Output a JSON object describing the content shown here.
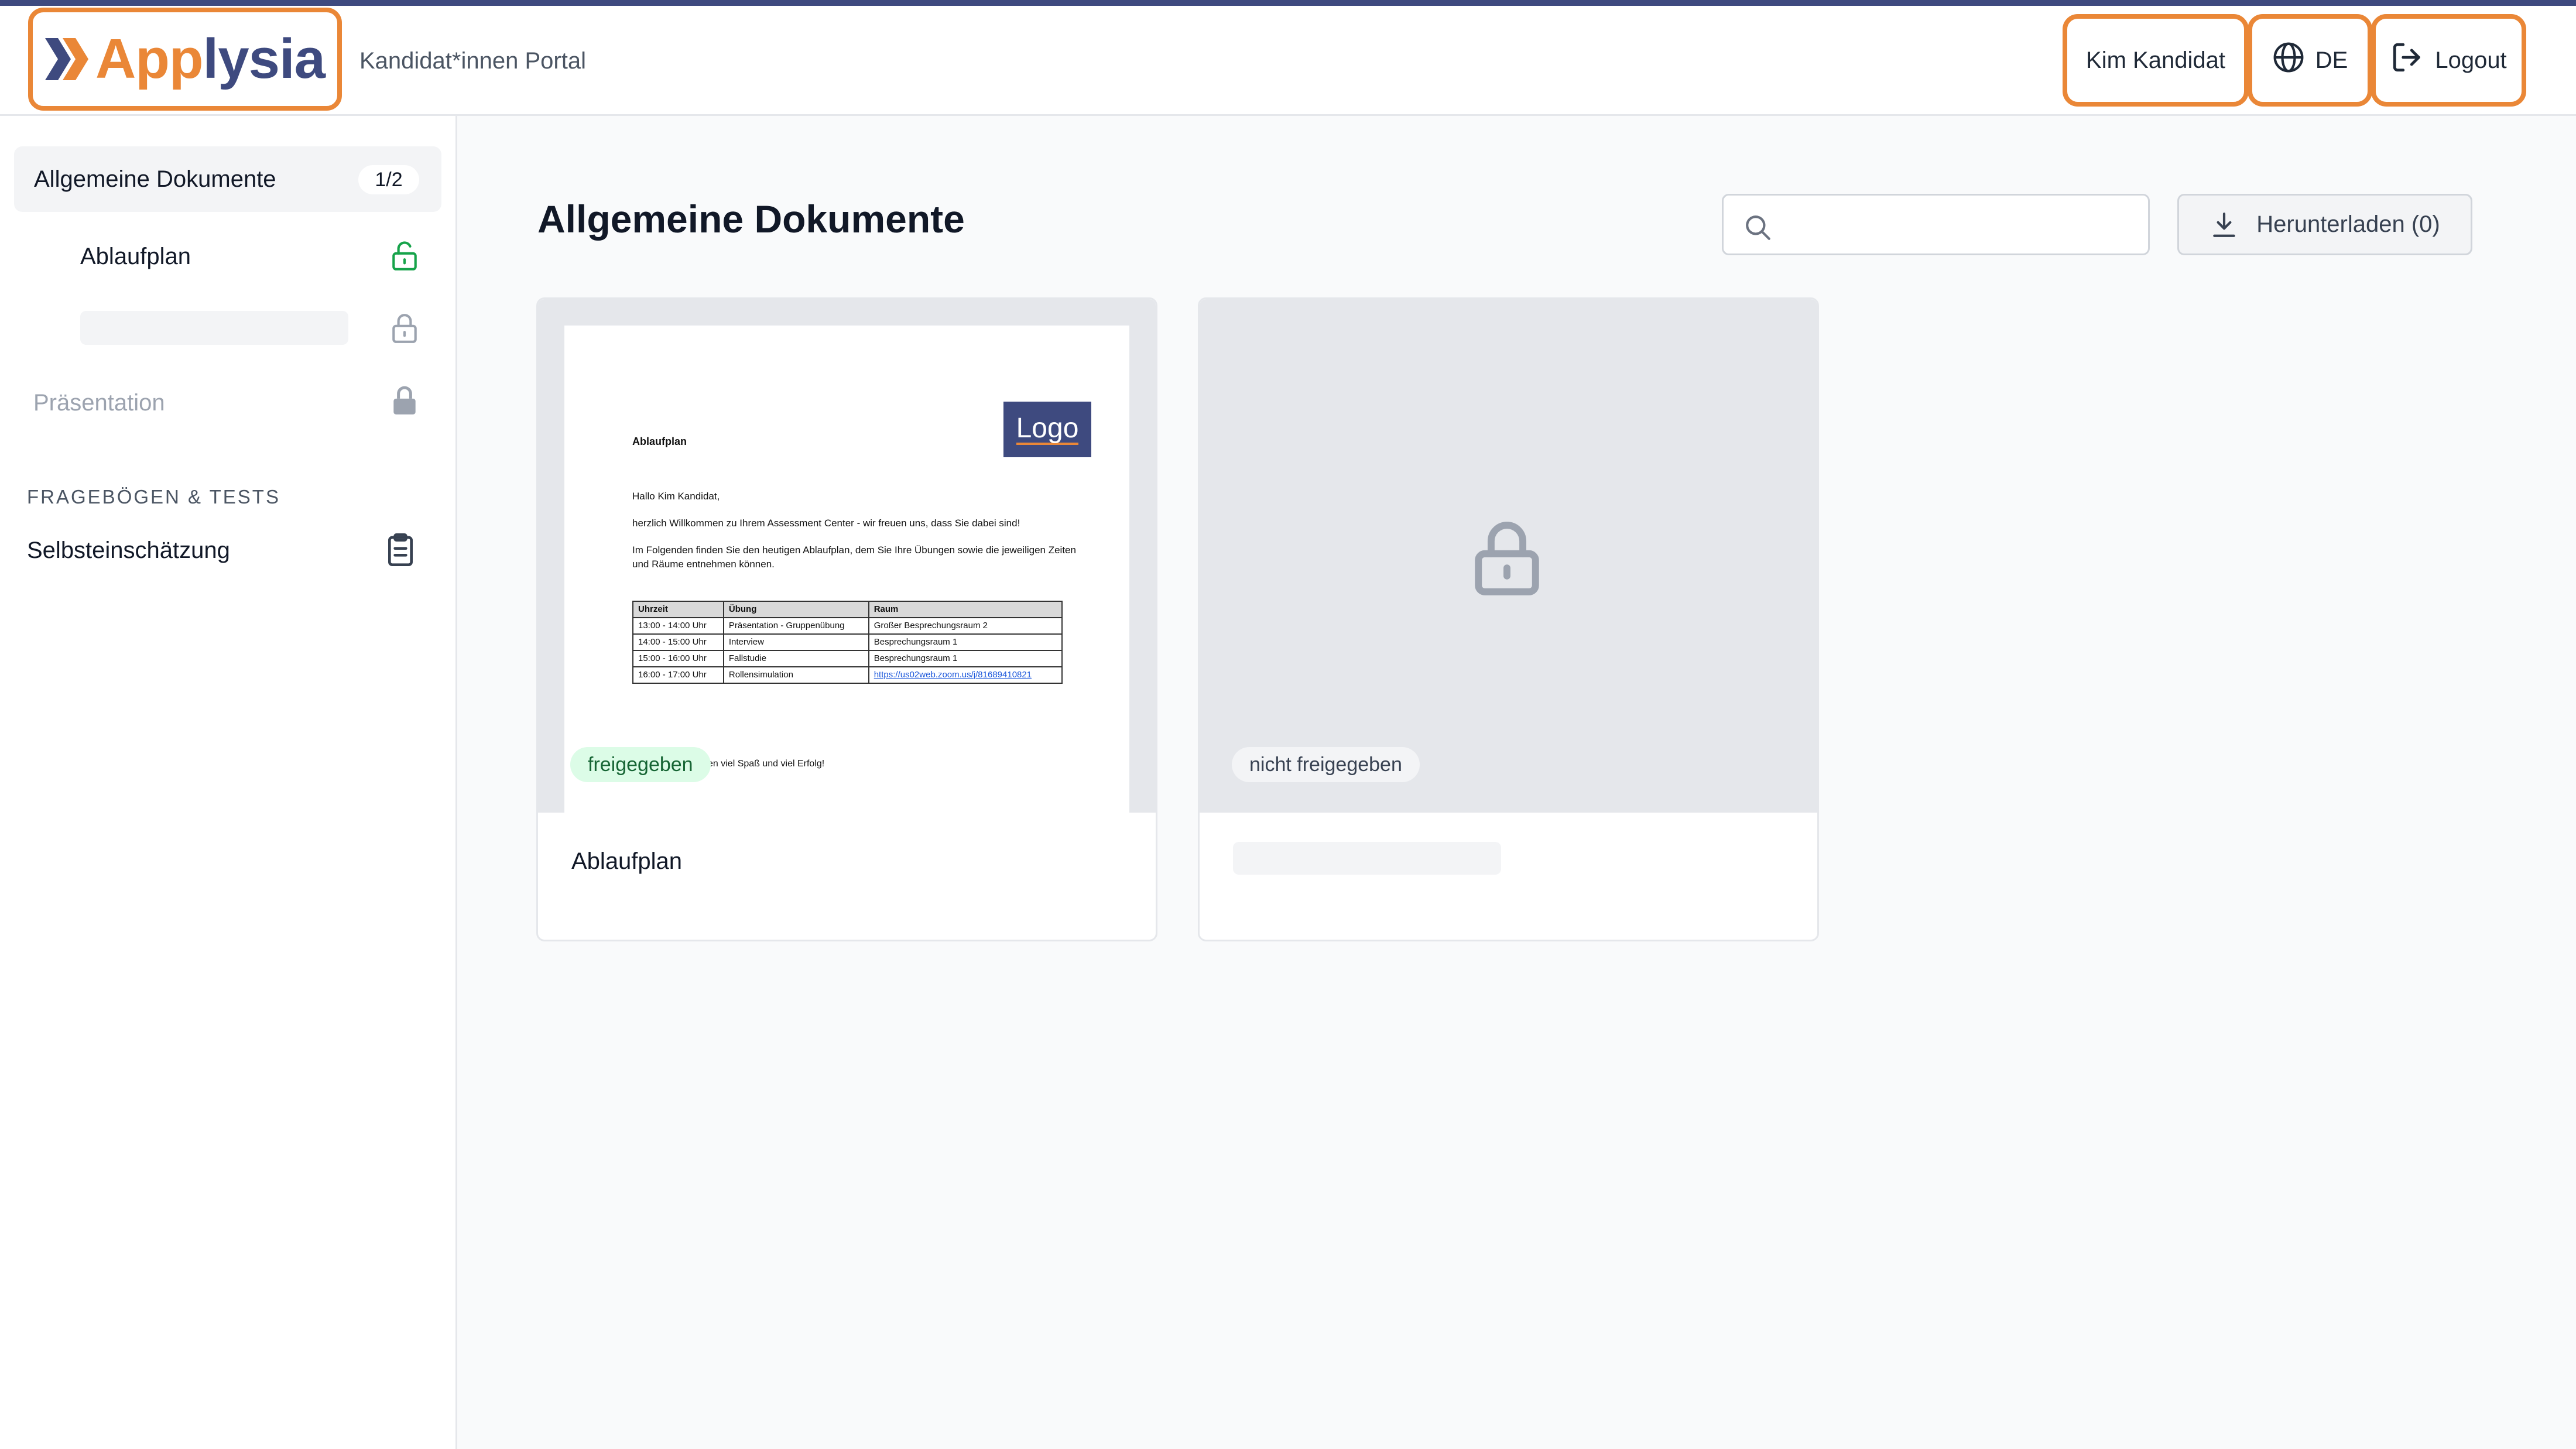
{
  "header": {
    "logo": {
      "part1": "App",
      "part2": "lysia"
    },
    "portal_label": "Kandidat*innen Portal",
    "user_name": "Kim Kandidat",
    "language": "DE",
    "logout_label": "Logout"
  },
  "sidebar": {
    "items": [
      {
        "label": "Allgemeine Dokumente",
        "badge": "1/2"
      },
      {
        "label": "Ablaufplan",
        "icon": "lock-open-icon"
      },
      {
        "label": "",
        "icon": "lock-icon"
      },
      {
        "label": "Präsentation",
        "icon": "lock-filled-icon"
      }
    ],
    "section_heading": "FRAGEBÖGEN & TESTS",
    "section_items": [
      {
        "label": "Selbsteinschätzung",
        "icon": "clipboard-icon"
      }
    ]
  },
  "main": {
    "title": "Allgemeine Dokumente",
    "search_placeholder": "",
    "download_label": "Herunterladen (0)",
    "cards": [
      {
        "title": "Ablaufplan",
        "status": "freigegeben",
        "preview": {
          "logo": "Logo",
          "heading": "Ablaufplan",
          "greeting": "Hallo Kim Kandidat,",
          "intro": "herzlich Willkommen zu Ihrem Assessment Center - wir freuen uns, dass Sie dabei sind!",
          "text": "Im Folgenden finden Sie den heutigen Ablaufplan, dem Sie Ihre Übungen sowie die jeweiligen Zeiten und Räume entnehmen können.",
          "table_header": [
            "Uhrzeit",
            "Übung",
            "Raum"
          ],
          "rows": [
            [
              "13:00 - 14:00 Uhr",
              "Präsentation - Gruppenübung",
              "Großer Besprechungsraum 2"
            ],
            [
              "14:00 - 15:00 Uhr",
              "Interview",
              "Besprechungsraum 1"
            ],
            [
              "15:00 - 16:00 Uhr",
              "Fallstudie",
              "Besprechungsraum 1"
            ],
            [
              "16:00 - 17:00 Uhr",
              "Rollensimulation",
              "https://us02web.zoom.us/j/81689410821"
            ]
          ],
          "closing": "en viel Spaß und viel Erfolg!"
        }
      },
      {
        "title": "",
        "status": "nicht freigegeben"
      }
    ]
  },
  "colors": {
    "brand_orange": "#ea8737",
    "brand_navy": "#3e4a7f",
    "success_green": "#16a34a"
  }
}
